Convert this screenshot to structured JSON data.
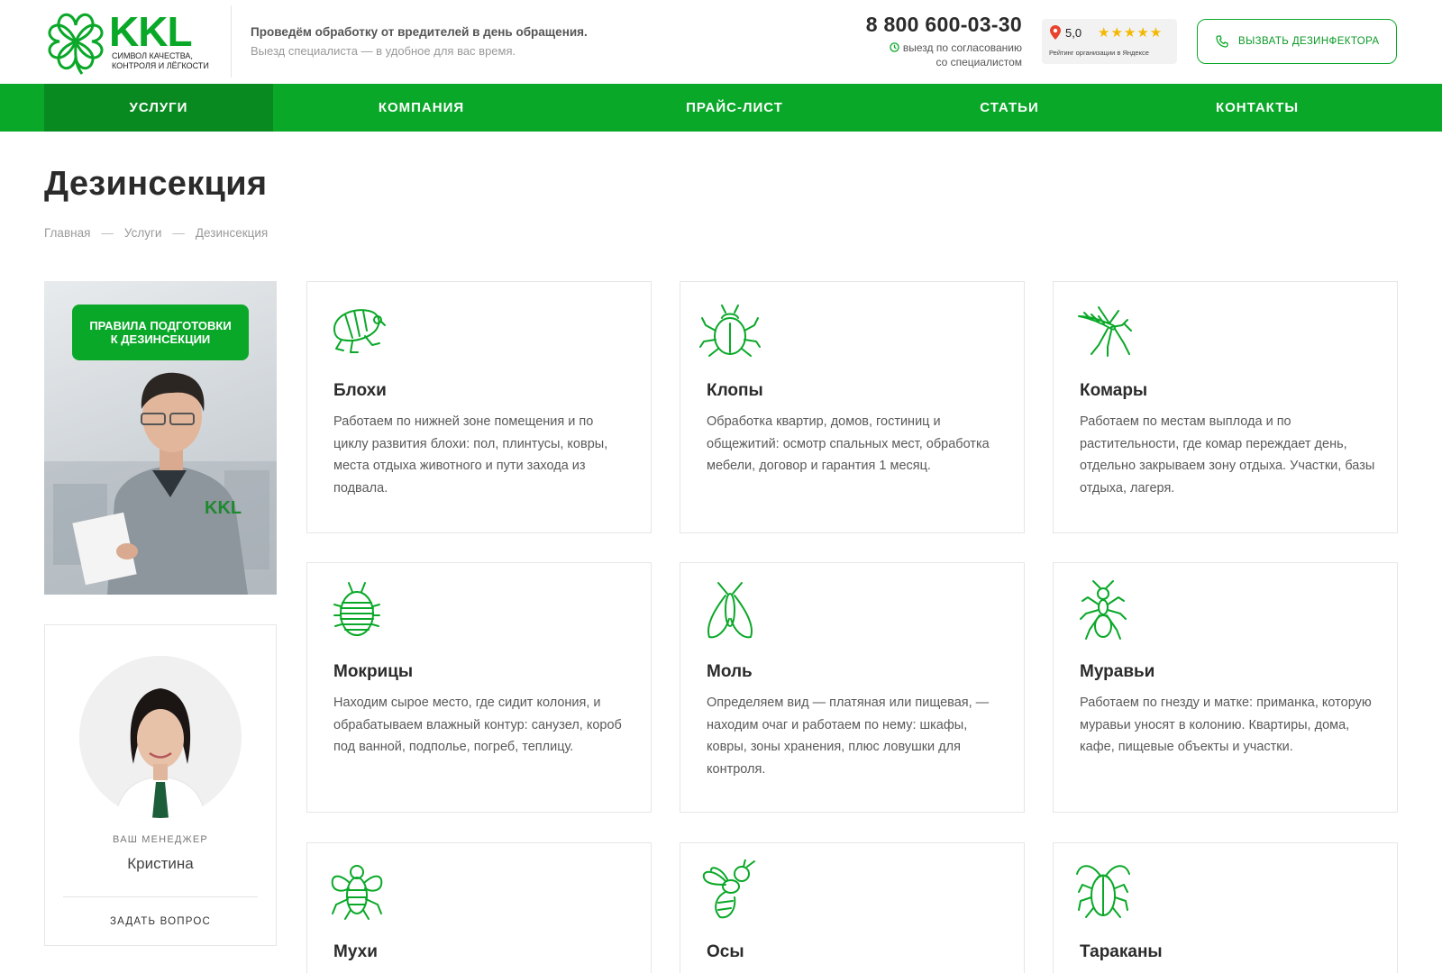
{
  "header": {
    "logo_text": "KKL",
    "logo_subtitle_line1": "символ качества,",
    "logo_subtitle_line2": "контроля и лёгкости",
    "tagline": "Проведём обработку от вредителей в день обращения.",
    "tagline_sub": "Выезд специалиста — в удобное для вас время.",
    "phone": "8 800 600-03-30",
    "visit_note_line1": "выезд по согласованию",
    "visit_note_line2": "со специалистом",
    "rating_value": "5,0",
    "rating_stars": "★★★★★",
    "rating_caption": "Рейтинг организации в Яндексе",
    "call_button": "Вызвать дезинфектора"
  },
  "nav": {
    "items": [
      {
        "label": "Услуги"
      },
      {
        "label": "Компания"
      },
      {
        "label": "Прайс-лист"
      },
      {
        "label": "Статьи"
      },
      {
        "label": "Контакты"
      }
    ],
    "active_index": 0
  },
  "page": {
    "title": "Дезинсекция",
    "breadcrumb": [
      "Главная",
      "Услуги",
      "Дезинсекция"
    ],
    "breadcrumb_separator": "—"
  },
  "promo": {
    "button_line1": "Правила подготовки",
    "button_line2": "к дезинсекции"
  },
  "manager": {
    "role": "Ваш менеджер",
    "name": "Кристина",
    "ask_button": "Задать вопрос"
  },
  "cards": [
    {
      "icon": "flea-icon",
      "title": "Блохи",
      "text": "Работаем по нижней зоне помещения и по циклу развития блохи: пол, плинтусы, ковры, места отдыха животного и пути захода из подвала."
    },
    {
      "icon": "bedbug-icon",
      "title": "Клопы",
      "text": "Обработка квартир, домов, гостиниц и общежитий: осмотр спальных мест, обработка мебели, договор и гарантия 1 месяц."
    },
    {
      "icon": "mosquito-icon",
      "title": "Комары",
      "text": "Работаем по местам выплода и по растительности, где комар переждает день, отдельно закрываем зону отдыха. Участки, базы отдыха, лагеря."
    },
    {
      "icon": "woodlouse-icon",
      "title": "Мокрицы",
      "text": "Находим сырое место, где сидит колония, и обрабатываем влажный контур: санузел, короб под ванной, подполье, погреб, теплицу."
    },
    {
      "icon": "moth-icon",
      "title": "Моль",
      "text": "Определяем вид — платяная или пищевая, — находим очаг и работаем по нему: шкафы, ковры, зоны хранения, плюс ловушки для контроля."
    },
    {
      "icon": "ant-icon",
      "title": "Муравьи",
      "text": "Работаем по гнезду и матке: приманка, которую муравьи уносят в колонию. Квартиры, дома, кафе, пищевые объекты и участки."
    },
    {
      "icon": "fly-icon",
      "title": "Мухи",
      "text": ""
    },
    {
      "icon": "wasp-icon",
      "title": "Осы",
      "text": ""
    },
    {
      "icon": "cockroach-icon",
      "title": "Тараканы",
      "text": ""
    }
  ],
  "colors": {
    "brand_green": "#0aa828",
    "nav_active": "#088a20",
    "star_yellow": "#f5b800",
    "map_pin_red": "#e8412c"
  }
}
